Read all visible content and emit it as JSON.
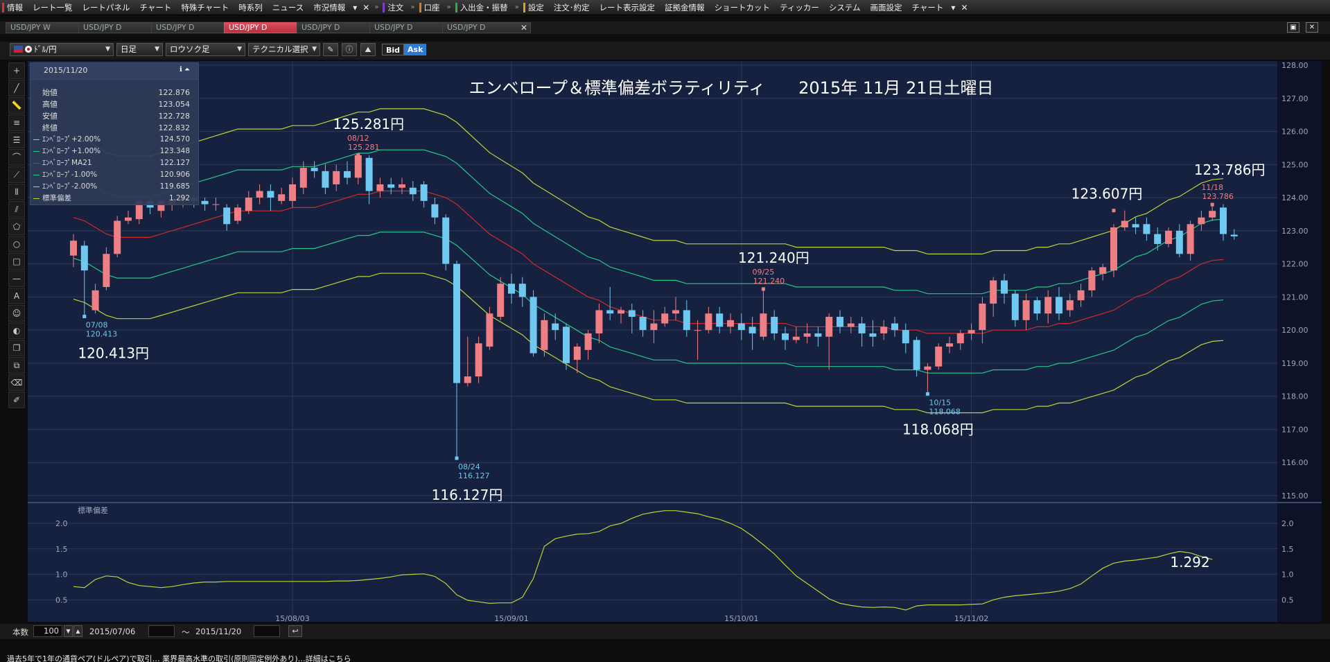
{
  "menu": {
    "items": [
      {
        "label": "情報",
        "mark": "#e03030"
      },
      {
        "label": "レート一覧"
      },
      {
        "label": "レートパネル"
      },
      {
        "label": "チャート"
      },
      {
        "label": "特殊チャート"
      },
      {
        "label": "時系列"
      },
      {
        "label": "ニュース"
      },
      {
        "label": "市況情報"
      },
      {
        "label": "注文",
        "mark": "#7a3fd0"
      },
      {
        "label": "口座",
        "mark": "#e07a20"
      },
      {
        "label": "入出金・振替",
        "mark": "#30b040"
      },
      {
        "label": "設定",
        "mark": "#e0a020"
      },
      {
        "label": "注文･約定"
      },
      {
        "label": "レート表示設定"
      },
      {
        "label": "証拠金情報"
      },
      {
        "label": "ショートカット"
      },
      {
        "label": "ティッカー"
      },
      {
        "label": "システム"
      },
      {
        "label": "画面設定"
      },
      {
        "label": "チャート"
      }
    ]
  },
  "tabs": [
    {
      "label": "USD/JPY W",
      "active": false
    },
    {
      "label": "USD/JPY D",
      "active": false
    },
    {
      "label": "USD/JPY D",
      "active": false
    },
    {
      "label": "USD/JPY D",
      "active": true
    },
    {
      "label": "USD/JPY D",
      "active": false
    },
    {
      "label": "USD/JPY D",
      "active": false
    },
    {
      "label": "USD/JPY D",
      "active": false
    }
  ],
  "toolbar": {
    "pair": "ﾄﾞﾙ/円",
    "period": "日足",
    "chart_type": "ロウソク足",
    "technical": "テクニカル選択",
    "bid": "Bid",
    "ask": "Ask"
  },
  "datawin": {
    "date": "2015/11/20",
    "ohlc": [
      {
        "label": "始値",
        "value": "122.876"
      },
      {
        "label": "高値",
        "value": "123.054"
      },
      {
        "label": "安値",
        "value": "122.728"
      },
      {
        "label": "終値",
        "value": "122.832"
      }
    ],
    "indicators": [
      {
        "label": "ｴﾝﾍﾞﾛｰﾌﾟ+2.00%",
        "value": "124.570",
        "color": "#b7d63a"
      },
      {
        "label": "ｴﾝﾍﾞﾛｰﾌﾟ+1.00%",
        "value": "123.348",
        "color": "#22c98a"
      },
      {
        "label": "ｴﾝﾍﾞﾛｰﾌﾟMA21",
        "value": "122.127",
        "color": "#d02a2a"
      },
      {
        "label": "ｴﾝﾍﾞﾛｰﾌﾟ-1.00%",
        "value": "120.906",
        "color": "#22c98a"
      },
      {
        "label": "ｴﾝﾍﾞﾛｰﾌﾟ-2.00%",
        "value": "119.685",
        "color": "#b7d63a"
      },
      {
        "label": "標準偏差",
        "value": "1.292",
        "color": "#b7d63a"
      }
    ]
  },
  "chart_title": "エンベロープ＆標準偏差ボラティリティ　　2015年 11月  21日土曜日",
  "chart_data": {
    "type": "candlestick",
    "ylim": [
      115.0,
      128.0
    ],
    "yticks": [
      "128.00",
      "127.00",
      "126.00",
      "125.00",
      "124.00",
      "123.00",
      "122.00",
      "121.00",
      "120.00",
      "119.00",
      "118.00",
      "117.00",
      "116.00",
      "115.00"
    ],
    "xticks": [
      {
        "index": 20,
        "label": "15/08/03"
      },
      {
        "index": 40,
        "label": "15/09/01"
      },
      {
        "index": 61,
        "label": "15/10/01"
      },
      {
        "index": 82,
        "label": "15/11/02"
      }
    ],
    "candles": [
      [
        122.25,
        122.7,
        122.9,
        121.9
      ],
      [
        122.55,
        121.8,
        122.7,
        120.41
      ],
      [
        120.6,
        121.2,
        121.4,
        120.5
      ],
      [
        121.3,
        122.3,
        122.5,
        121.2
      ],
      [
        122.3,
        123.3,
        123.45,
        122.2
      ],
      [
        123.3,
        123.4,
        123.6,
        123.2
      ],
      [
        123.35,
        123.9,
        124.0,
        123.2
      ],
      [
        123.9,
        123.7,
        124.0,
        123.5
      ],
      [
        123.6,
        123.9,
        124.0,
        123.4
      ],
      [
        123.8,
        123.95,
        124.1,
        123.6
      ],
      [
        123.9,
        124.05,
        124.2,
        123.7
      ],
      [
        124.0,
        123.9,
        124.2,
        123.7
      ],
      [
        123.9,
        123.8,
        124.0,
        123.6
      ],
      [
        123.8,
        123.8,
        124.0,
        123.6
      ],
      [
        123.7,
        123.2,
        123.8,
        123.0
      ],
      [
        123.3,
        123.7,
        123.8,
        123.2
      ],
      [
        123.6,
        124.0,
        124.2,
        123.5
      ],
      [
        124.0,
        124.2,
        124.4,
        123.8
      ],
      [
        124.2,
        124.0,
        124.4,
        123.6
      ],
      [
        123.9,
        124.1,
        124.3,
        123.8
      ],
      [
        123.9,
        124.4,
        124.6,
        123.7
      ],
      [
        124.3,
        124.9,
        125.1,
        124.1
      ],
      [
        124.9,
        124.8,
        125.1,
        124.6
      ],
      [
        124.8,
        124.3,
        125.0,
        124.1
      ],
      [
        124.4,
        124.8,
        125.0,
        124.2
      ],
      [
        124.8,
        124.6,
        125.1,
        124.4
      ],
      [
        124.6,
        125.28,
        125.28,
        124.4
      ],
      [
        125.2,
        124.2,
        125.28,
        123.8
      ],
      [
        124.2,
        124.4,
        124.6,
        124.0
      ],
      [
        124.4,
        124.3,
        124.6,
        124.1
      ],
      [
        124.3,
        124.4,
        124.6,
        124.1
      ],
      [
        124.3,
        124.1,
        124.5,
        123.9
      ],
      [
        124.4,
        123.9,
        124.5,
        123.7
      ],
      [
        123.8,
        123.4,
        124.0,
        123.2
      ],
      [
        123.4,
        122.0,
        123.5,
        121.8
      ],
      [
        122.0,
        118.4,
        122.1,
        116.13
      ],
      [
        118.4,
        118.6,
        119.8,
        118.3
      ],
      [
        118.6,
        119.6,
        119.8,
        118.4
      ],
      [
        119.5,
        120.5,
        120.7,
        119.4
      ],
      [
        120.4,
        121.4,
        121.6,
        120.3
      ],
      [
        121.4,
        121.1,
        121.7,
        120.8
      ],
      [
        121.4,
        121.0,
        121.6,
        120.7
      ],
      [
        121.0,
        119.3,
        121.2,
        119.2
      ],
      [
        119.4,
        120.3,
        120.5,
        119.2
      ],
      [
        120.2,
        120.0,
        120.5,
        119.7
      ],
      [
        120.1,
        119.0,
        120.2,
        118.8
      ],
      [
        119.1,
        119.5,
        119.6,
        118.7
      ],
      [
        119.4,
        119.9,
        120.0,
        119.1
      ],
      [
        119.9,
        120.6,
        120.8,
        119.6
      ],
      [
        120.6,
        120.5,
        121.3,
        120.3
      ],
      [
        120.5,
        120.6,
        120.7,
        120.2
      ],
      [
        120.6,
        120.4,
        120.8,
        119.9
      ],
      [
        120.4,
        120.0,
        120.6,
        119.8
      ],
      [
        120.0,
        120.2,
        120.6,
        119.6
      ],
      [
        120.2,
        120.5,
        120.7,
        120.1
      ],
      [
        120.5,
        120.6,
        121.0,
        120.3
      ],
      [
        120.6,
        120.0,
        120.9,
        119.8
      ],
      [
        120.0,
        120.0,
        120.3,
        119.1
      ],
      [
        120.0,
        120.5,
        120.7,
        119.9
      ],
      [
        120.5,
        120.1,
        120.7,
        119.9
      ],
      [
        120.1,
        120.3,
        120.5,
        119.9
      ],
      [
        120.2,
        120.0,
        120.5,
        119.7
      ],
      [
        120.1,
        119.9,
        120.4,
        119.4
      ],
      [
        119.8,
        120.5,
        121.24,
        119.7
      ],
      [
        120.4,
        119.9,
        120.6,
        119.7
      ],
      [
        119.9,
        119.7,
        120.1,
        119.4
      ],
      [
        119.7,
        119.8,
        120.1,
        119.6
      ],
      [
        119.8,
        119.9,
        120.2,
        119.6
      ],
      [
        119.9,
        119.8,
        120.1,
        119.5
      ],
      [
        119.8,
        120.4,
        120.5,
        118.8
      ],
      [
        120.4,
        120.1,
        120.6,
        119.9
      ],
      [
        120.1,
        120.2,
        120.4,
        119.9
      ],
      [
        120.2,
        119.9,
        120.4,
        119.5
      ],
      [
        119.9,
        119.8,
        120.3,
        119.5
      ],
      [
        119.9,
        120.1,
        120.3,
        119.7
      ],
      [
        120.2,
        120.0,
        120.4,
        119.8
      ],
      [
        120.0,
        119.6,
        120.2,
        119.3
      ],
      [
        119.7,
        118.8,
        119.8,
        118.6
      ],
      [
        118.8,
        118.9,
        119.0,
        118.07
      ],
      [
        118.9,
        119.5,
        119.6,
        118.8
      ],
      [
        119.5,
        119.6,
        119.8,
        119.3
      ],
      [
        119.6,
        119.9,
        120.0,
        119.4
      ],
      [
        119.9,
        120.0,
        120.2,
        119.7
      ],
      [
        120.0,
        120.8,
        121.0,
        119.6
      ],
      [
        120.8,
        121.5,
        121.6,
        120.4
      ],
      [
        121.5,
        121.1,
        121.7,
        120.8
      ],
      [
        121.1,
        120.3,
        121.2,
        120.1
      ],
      [
        120.3,
        120.9,
        121.1,
        120.0
      ],
      [
        120.9,
        120.5,
        121.0,
        120.3
      ],
      [
        120.5,
        121.0,
        121.2,
        120.2
      ],
      [
        121.0,
        120.5,
        121.3,
        120.3
      ],
      [
        120.6,
        120.9,
        121.1,
        120.4
      ],
      [
        120.9,
        121.2,
        121.4,
        120.7
      ],
      [
        121.2,
        121.8,
        121.9,
        121.0
      ],
      [
        121.7,
        121.9,
        122.0,
        121.5
      ],
      [
        121.8,
        123.1,
        123.2,
        121.6
      ],
      [
        123.1,
        123.3,
        123.61,
        123.0
      ],
      [
        123.2,
        123.1,
        123.4,
        122.9
      ],
      [
        123.2,
        122.9,
        123.4,
        122.7
      ],
      [
        122.9,
        122.6,
        123.1,
        122.4
      ],
      [
        122.6,
        123.0,
        123.1,
        122.5
      ],
      [
        123.0,
        122.3,
        123.2,
        122.2
      ],
      [
        122.3,
        123.2,
        123.3,
        122.1
      ],
      [
        123.2,
        123.4,
        123.6,
        123.0
      ],
      [
        123.4,
        123.6,
        123.79,
        123.3
      ],
      [
        123.7,
        122.9,
        123.8,
        122.7
      ],
      [
        122.88,
        122.83,
        123.05,
        122.73
      ]
    ],
    "ma21": [
      123.4,
      123.3,
      123.1,
      122.9,
      122.8,
      122.8,
      122.8,
      122.8,
      122.9,
      123.0,
      123.1,
      123.2,
      123.3,
      123.4,
      123.5,
      123.6,
      123.6,
      123.6,
      123.6,
      123.6,
      123.7,
      123.7,
      123.7,
      123.8,
      123.9,
      124.0,
      124.1,
      124.1,
      124.2,
      124.2,
      124.2,
      124.2,
      124.2,
      124.1,
      124.0,
      123.8,
      123.5,
      123.2,
      122.9,
      122.7,
      122.5,
      122.3,
      122.0,
      121.8,
      121.6,
      121.4,
      121.2,
      121.0,
      120.9,
      120.7,
      120.6,
      120.5,
      120.4,
      120.3,
      120.3,
      120.3,
      120.2,
      120.2,
      120.2,
      120.2,
      120.2,
      120.2,
      120.2,
      120.2,
      120.2,
      120.2,
      120.1,
      120.1,
      120.1,
      120.1,
      120.1,
      120.1,
      120.1,
      120.1,
      120.1,
      120.0,
      120.0,
      120.0,
      119.9,
      119.9,
      119.9,
      119.9,
      119.9,
      119.9,
      120.0,
      120.0,
      120.0,
      120.0,
      120.1,
      120.1,
      120.2,
      120.2,
      120.3,
      120.4,
      120.5,
      120.6,
      120.8,
      121.0,
      121.1,
      121.3,
      121.5,
      121.6,
      121.8,
      122.0,
      122.1,
      122.13
    ],
    "envelope_pct": [
      -2,
      -1,
      1,
      2
    ],
    "stddev": {
      "label": "標準偏差",
      "ylim": [
        0.3,
        2.3
      ],
      "yticks": [
        "2.0",
        "1.5",
        "1.0",
        "0.5"
      ],
      "values": [
        0.76,
        0.74,
        0.9,
        0.97,
        0.95,
        0.84,
        0.78,
        0.76,
        0.74,
        0.76,
        0.8,
        0.83,
        0.85,
        0.85,
        0.86,
        0.86,
        0.86,
        0.86,
        0.86,
        0.86,
        0.86,
        0.86,
        0.86,
        0.86,
        0.87,
        0.87,
        0.88,
        0.9,
        0.92,
        0.95,
        0.99,
        1.0,
        1.01,
        0.96,
        0.82,
        0.6,
        0.49,
        0.46,
        0.43,
        0.44,
        0.44,
        0.55,
        0.92,
        1.55,
        1.7,
        1.75,
        1.79,
        1.8,
        1.84,
        1.95,
        2.0,
        2.1,
        2.18,
        2.22,
        2.25,
        2.25,
        2.22,
        2.19,
        2.13,
        2.08,
        2.0,
        1.9,
        1.75,
        1.58,
        1.4,
        1.18,
        0.97,
        0.82,
        0.67,
        0.52,
        0.43,
        0.39,
        0.36,
        0.35,
        0.36,
        0.35,
        0.3,
        0.38,
        0.4,
        0.4,
        0.4,
        0.4,
        0.41,
        0.42,
        0.5,
        0.55,
        0.58,
        0.6,
        0.62,
        0.64,
        0.67,
        0.72,
        0.81,
        0.97,
        1.12,
        1.22,
        1.26,
        1.28,
        1.31,
        1.34,
        1.4,
        1.45,
        1.42,
        1.35,
        1.292
      ]
    },
    "annotations": [
      {
        "index": 1,
        "value": 120.41,
        "date": "07/08",
        "price": "120.413",
        "big": "120.413円",
        "color": "#6fc8f0"
      },
      {
        "index": 26,
        "value": 125.28,
        "date": "08/12",
        "price": "125.281",
        "big": "125.281円",
        "color": "#f07f85"
      },
      {
        "index": 35,
        "value": 116.13,
        "date": "08/24",
        "price": "116.127",
        "big": "116.127円",
        "color": "#6fc8f0"
      },
      {
        "index": 63,
        "value": 121.24,
        "date": "09/25",
        "price": "121.240",
        "big": "121.240円",
        "color": "#f07f85"
      },
      {
        "index": 78,
        "value": 118.07,
        "date": "10/15",
        "price": "118.068",
        "big": "118.068円",
        "color": "#6fc8f0"
      },
      {
        "index": 95,
        "value": 123.61,
        "date": "",
        "price": "",
        "big": "123.607円",
        "color": "#f07f85"
      },
      {
        "index": 104,
        "value": 123.79,
        "date": "11/18",
        "price": "123.786",
        "big": "123.786円",
        "color": "#f07f85"
      }
    ],
    "stddev_last_label": "1.292",
    "colors": {
      "up": "#f07f85",
      "down": "#6fc8f0",
      "ma": "#d02a2a",
      "env1": "#22c98a",
      "env2": "#b7d63a",
      "bg": "#16213f",
      "grid": "#2b385a"
    }
  },
  "bottombar": {
    "count_label": "本数",
    "count_value": "100",
    "from_date": "2015/07/06",
    "tilde": "〜",
    "to_date": "2015/11/20"
  },
  "ticker_text": "過去5年で1年の通貨ペア(ドルペア)で取引… 業界最高水準の取引(原則固定例外あり)…詳細はこちら"
}
